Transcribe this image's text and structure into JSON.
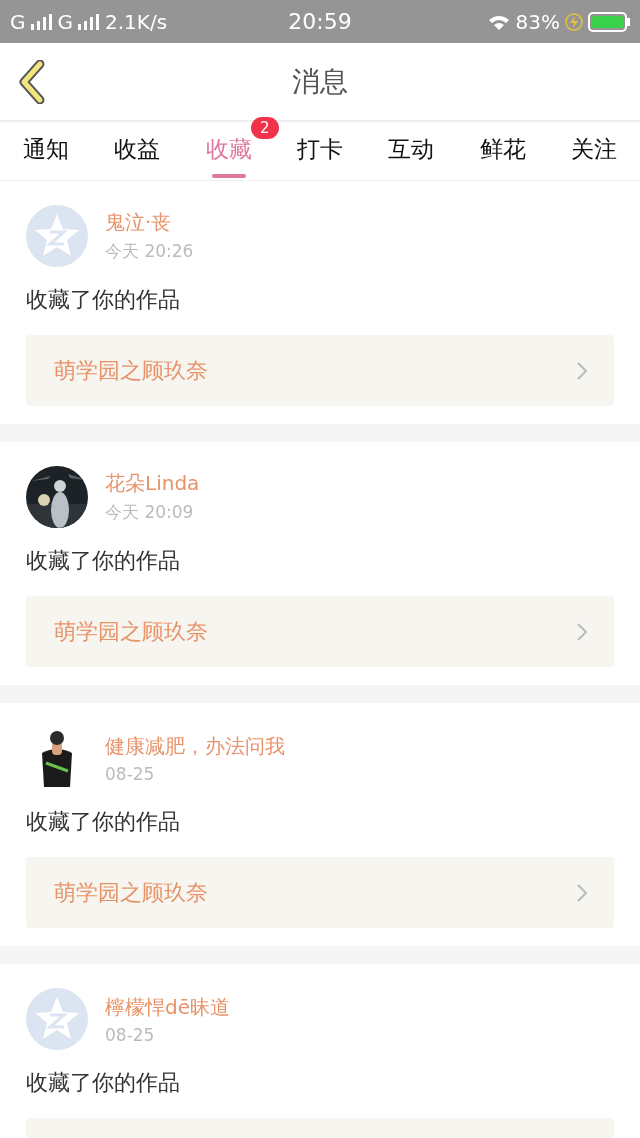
{
  "status_bar": {
    "carrier_1": "G",
    "carrier_2": "G",
    "speed": "2.1K/s",
    "time": "20:59",
    "battery": "83%"
  },
  "header": {
    "title": "消息"
  },
  "tabs": [
    {
      "label": "通知",
      "selected": false
    },
    {
      "label": "收益",
      "selected": false
    },
    {
      "label": "收藏",
      "selected": true,
      "badge": "2"
    },
    {
      "label": "打卡",
      "selected": false
    },
    {
      "label": "互动",
      "selected": false
    },
    {
      "label": "鲜花",
      "selected": false
    },
    {
      "label": "关注",
      "selected": false
    }
  ],
  "messages": [
    {
      "name": "鬼泣·丧",
      "time": "今天 20:26",
      "avatar": {
        "kind": "default"
      },
      "text": "收藏了你的作品",
      "work": "萌学园之顾玖奈"
    },
    {
      "name": "花朵Linda",
      "time": "今天 20:09",
      "text": "收藏了你的作品",
      "work": "萌学园之顾玖奈"
    },
    {
      "name": "健康减肥，办法问我",
      "time": "08-25",
      "avatar": {
        "kind": "figure"
      },
      "text": "收藏了你的作品",
      "work": "萌学园之顾玖奈"
    },
    {
      "name": "檸檬悍dē昧道",
      "time": "08-25",
      "avatar": {
        "kind": "default"
      },
      "text": "收藏了你的作品",
      "empty_work_box": true
    }
  ]
}
